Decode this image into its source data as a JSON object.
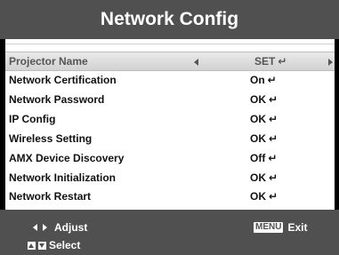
{
  "title": "Network Config",
  "menu": {
    "items": [
      {
        "label": "Projector Name",
        "value": "SET",
        "enter": "↵"
      },
      {
        "label": "Network Certification",
        "value": "On",
        "enter": "↵"
      },
      {
        "label": "Network Password",
        "value": "OK",
        "enter": "↵"
      },
      {
        "label": "IP Config",
        "value": "OK",
        "enter": "↵"
      },
      {
        "label": "Wireless Setting",
        "value": "OK",
        "enter": "↵"
      },
      {
        "label": "AMX Device Discovery",
        "value": "Off",
        "enter": "↵"
      },
      {
        "label": "Network Initialization",
        "value": "OK",
        "enter": "↵"
      },
      {
        "label": "Network Restart",
        "value": "OK",
        "enter": "↵"
      }
    ],
    "selected_index": 0
  },
  "footer": {
    "adjust_label": "Adjust",
    "select_label": "Select",
    "menu_key": "MENU",
    "exit_label": "Exit"
  },
  "colors": {
    "bar_gray": "#505050",
    "panel_white": "#ffffff",
    "highlight_gray": "#d9d9d9"
  }
}
